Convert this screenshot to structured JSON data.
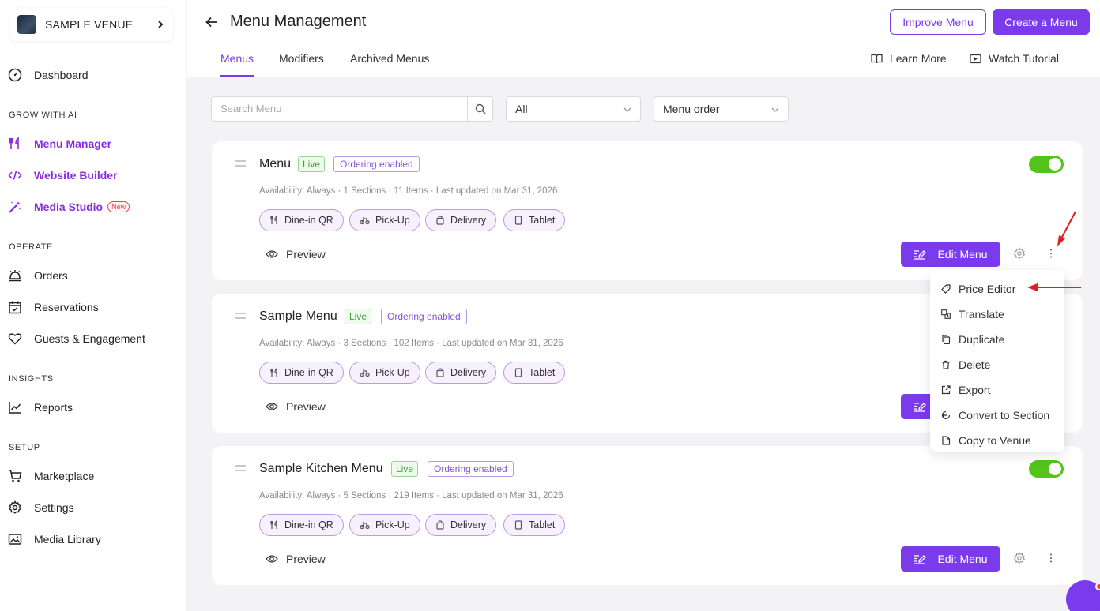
{
  "venue": {
    "name": "SAMPLE VENUE"
  },
  "sidebar": {
    "dashboard": "Dashboard",
    "grow_heading": "GROW WITH AI",
    "menu_manager": "Menu Manager",
    "website_builder": "Website Builder",
    "media_studio": "Media Studio",
    "new_badge": "New",
    "operate_heading": "OPERATE",
    "orders": "Orders",
    "reservations": "Reservations",
    "guests": "Guests & Engagement",
    "insights_heading": "INSIGHTS",
    "reports": "Reports",
    "setup_heading": "SETUP",
    "marketplace": "Marketplace",
    "settings": "Settings",
    "media_library": "Media Library"
  },
  "header": {
    "title": "Menu Management",
    "improve_menu": "Improve Menu",
    "create_menu": "Create a Menu",
    "tabs": [
      "Menus",
      "Modifiers",
      "Archived Menus"
    ],
    "learn_more": "Learn More",
    "watch_tutorial": "Watch Tutorial"
  },
  "filters": {
    "search_placeholder": "Search Menu",
    "status_value": "All",
    "order_value": "Menu order"
  },
  "common": {
    "live": "Live",
    "ordering_enabled": "Ordering enabled",
    "preview": "Preview",
    "edit_menu": "Edit Menu",
    "chips": [
      "Dine-in QR",
      "Pick-Up",
      "Delivery",
      "Tablet"
    ]
  },
  "menus": [
    {
      "title": "Menu",
      "meta": "Availability: Always · 1 Sections · 11 Items · Last updated on Mar 31, 2026"
    },
    {
      "title": "Sample Menu",
      "meta": "Availability: Always · 3 Sections · 102 Items · Last updated on Mar 31, 2026"
    },
    {
      "title": "Sample Kitchen Menu",
      "meta": "Availability: Always · 5 Sections · 219 Items · Last updated on Mar 31, 2026"
    }
  ],
  "dropdown": [
    "Price Editor",
    "Translate",
    "Duplicate",
    "Delete",
    "Export",
    "Convert to Section",
    "Copy to Venue"
  ],
  "colors": {
    "accent": "#7c3aed",
    "toggle_on": "#52c41a",
    "annotation_arrow": "#e11d1d"
  }
}
